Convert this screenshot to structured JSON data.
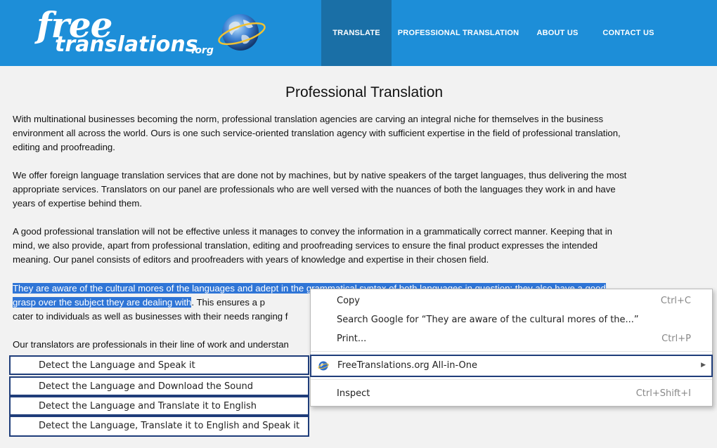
{
  "logo": {
    "word1": "free",
    "word2": "translations",
    "suffix": ".org"
  },
  "nav": [
    {
      "label": "TRANSLATE",
      "active": true
    },
    {
      "label": "PROFESSIONAL TRANSLATION",
      "active": false
    },
    {
      "label": "ABOUT US",
      "active": false
    },
    {
      "label": "CONTACT US",
      "active": false
    }
  ],
  "page": {
    "title": "Professional Translation",
    "paragraphs": [
      "With multinational businesses becoming the norm, professional translation agencies are carving an integral niche for themselves in the business environment all across the world. Ours is one such service-oriented translation agency with sufficient expertise in the field of professional translation, editing and proofreading.",
      "We offer foreign language translation services that are done not by machines, but by native speakers of the target languages, thus delivering the most appropriate services. Translators on our panel are professionals who are well versed with the nuances of both the languages they work in and have years of expertise behind them.",
      "A good professional translation will not be effective unless it manages to convey the information in a grammatically correct manner. Keeping that in mind, we also provide, apart from professional translation, editing and proofreading services to ensure the final product expresses the intended meaning. Our panel consists of editors and proofreaders with years of knowledge and expertise in their chosen field."
    ],
    "para4_selected": "They are aware of the cultural mores of the languages and adept in the grammatical syntax of both languages in question; they also have a good grasp over the subject they are dealing with",
    "para4_rest": ". This ensures a p",
    "para4_line3": "cater to individuals as well as businesses with their needs ranging f",
    "para5": "Our translators are professionals in their line of work and understan"
  },
  "context_menu": {
    "copy": {
      "label": "Copy",
      "shortcut": "Ctrl+C"
    },
    "search": {
      "label": "Search Google for “They are aware of the cultural mores of the...”"
    },
    "print": {
      "label": "Print...",
      "shortcut": "Ctrl+P"
    },
    "extension": {
      "label": "FreeTranslations.org All-in-One",
      "icon": "globe-icon"
    },
    "inspect": {
      "label": "Inspect",
      "shortcut": "Ctrl+Shift+I"
    }
  },
  "submenu": [
    "Detect the Language and Speak it",
    "Detect the Language and Download the Sound",
    "Detect the Language and Translate it to English",
    "Detect the Language,  Translate it to English and Speak it"
  ],
  "colors": {
    "header": "#1d8ed8",
    "nav_active": "#1a6fa6",
    "selection": "#2f75d6",
    "highlight_border": "#1f3d7a"
  }
}
